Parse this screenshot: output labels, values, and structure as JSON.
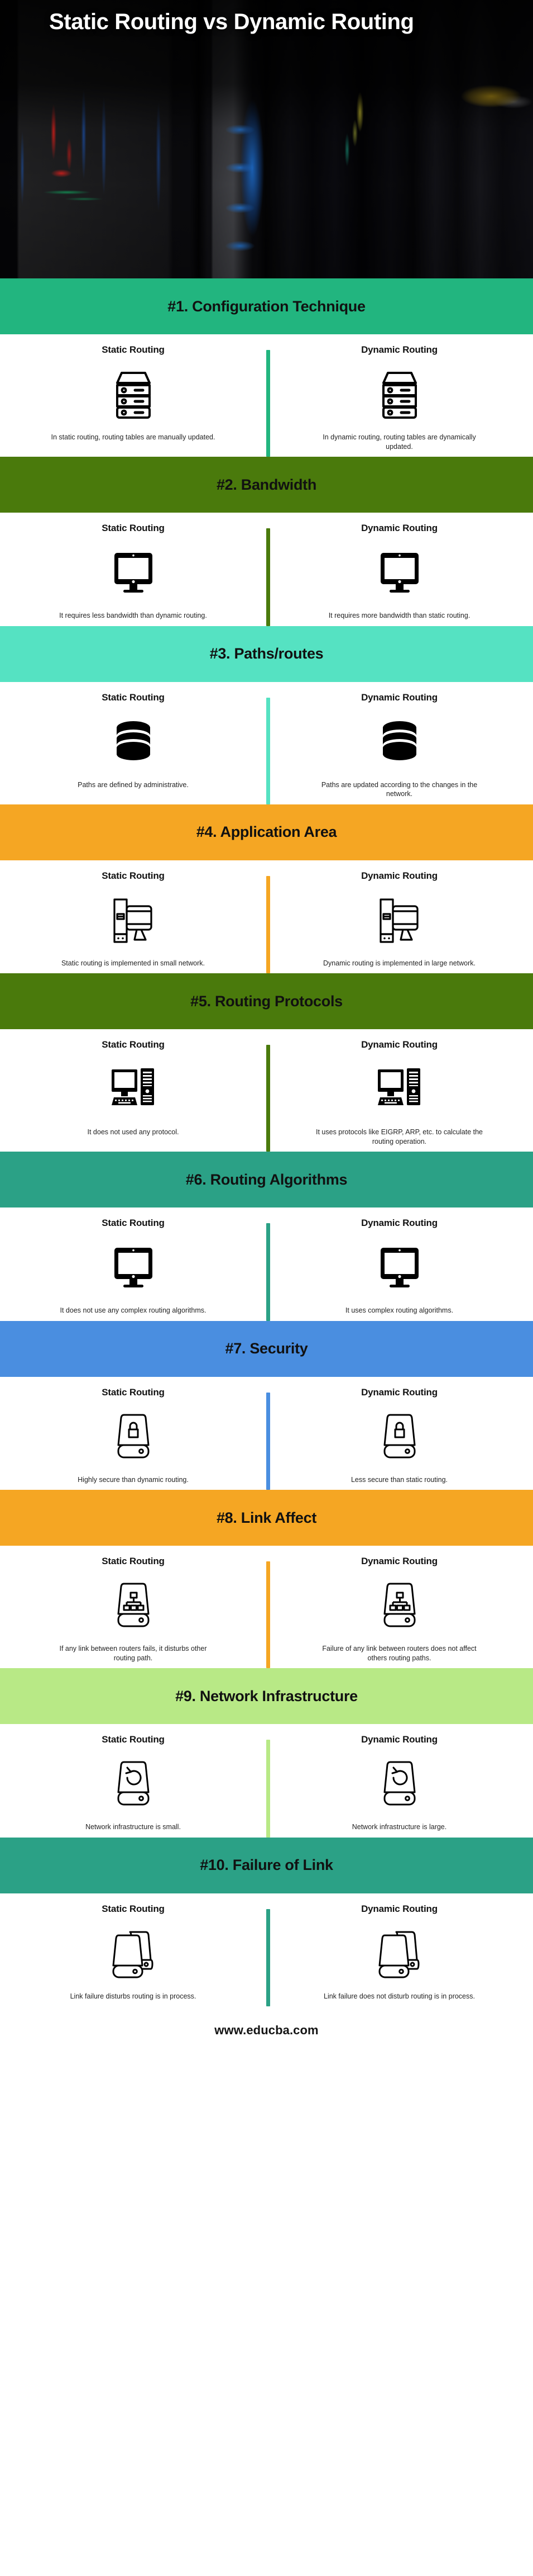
{
  "hero": {
    "title": "Static Routing vs Dynamic Routing",
    "image_alt": "server-racks-photo"
  },
  "column_headers": {
    "static": "Static Routing",
    "dynamic": "Dynamic Routing"
  },
  "footer": {
    "site": "www.educba.com"
  },
  "colors": {
    "green": "#22b57f",
    "olive": "#4a7a0c",
    "turquoise": "#55e2c2",
    "orange": "#f5a623",
    "teal": "#2ba186",
    "blue": "#4a8ee0",
    "light_green": "#b8e986",
    "text_dark": "#111111",
    "body_text": "#232323",
    "white": "#ffffff"
  },
  "sections": [
    {
      "number": "#1.",
      "heading": "#1. Configuration Technique",
      "color": "#22b57f",
      "icon": "server-rack-icon",
      "static_desc": "In static routing, routing tables are manually updated.",
      "dynamic_desc": "In dynamic routing, routing tables are dynamically updated."
    },
    {
      "number": "#2.",
      "heading": "#2. Bandwidth",
      "color": "#4a7a0c",
      "icon": "monitor-icon",
      "static_desc": "It requires less bandwidth than dynamic routing.",
      "dynamic_desc": "It requires more bandwidth than static routing."
    },
    {
      "number": "#3.",
      "heading": "#3. Paths/routes",
      "color": "#55e2c2",
      "icon": "database-icon",
      "static_desc": "Paths are defined by administrative.",
      "dynamic_desc": "Paths are updated according to the changes in the network."
    },
    {
      "number": "#4.",
      "heading": "#4. Application Area",
      "color": "#f5a623",
      "icon": "desktop-tower-outline-icon",
      "static_desc": "Static routing is implemented in small network.",
      "dynamic_desc": "Dynamic routing is implemented in large network."
    },
    {
      "number": "#5.",
      "heading": "#5. Routing Protocols",
      "color": "#4a7a0c",
      "icon": "desktop-computer-icon",
      "static_desc": "It does not used any protocol.",
      "dynamic_desc": "It uses protocols like EIGRP, ARP, etc. to calculate the routing operation."
    },
    {
      "number": "#6.",
      "heading": "#6. Routing Algorithms",
      "color": "#2ba186",
      "icon": "monitor-icon",
      "static_desc": "It does not use any complex routing algorithms.",
      "dynamic_desc": "It uses complex routing algorithms."
    },
    {
      "number": "#7.",
      "heading": "#7. Security",
      "color": "#4a8ee0",
      "icon": "router-lock-icon",
      "static_desc": "Highly secure than dynamic routing.",
      "dynamic_desc": "Less secure than static routing."
    },
    {
      "number": "#8.",
      "heading": "#8. Link Affect",
      "color": "#f5a623",
      "icon": "router-network-icon",
      "static_desc": "If any link between routers fails, it disturbs other routing path.",
      "dynamic_desc": "Failure of any link between routers does not affect others routing paths."
    },
    {
      "number": "#9.",
      "heading": "#9. Network Infrastructure",
      "color": "#b8e986",
      "icon": "router-refresh-icon",
      "static_desc": "Network infrastructure is small.",
      "dynamic_desc": "Network infrastructure is large."
    },
    {
      "number": "#10.",
      "heading": "#10. Failure of Link",
      "color": "#2ba186",
      "icon": "two-routers-icon",
      "static_desc": "Link failure disturbs routing is in process.",
      "dynamic_desc": "Link failure does not disturb routing is in process."
    }
  ]
}
